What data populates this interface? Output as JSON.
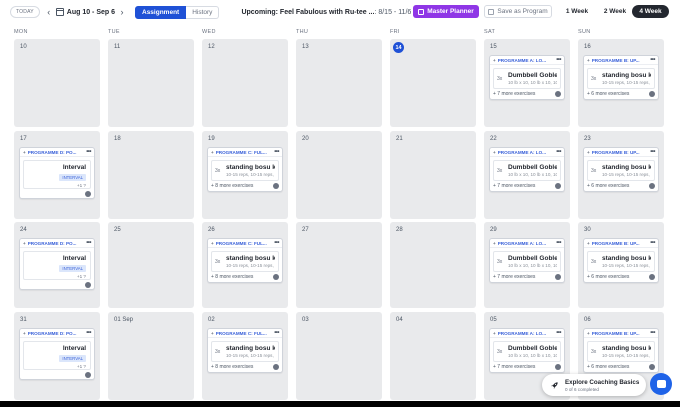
{
  "toolbar": {
    "today": "TODAY",
    "date_range": "Aug 10 - Sep 6",
    "tabs": [
      "Assignment",
      "History"
    ],
    "upcoming_title": "Upcoming: Feel Fabulous with Ru-tee ...",
    "upcoming_range": ": 8/15 - 11/6",
    "more": "•••",
    "master_planner": "Master Planner",
    "save_program": "Save as Program",
    "week_options": [
      "1 Week",
      "2 Week",
      "4 Week"
    ],
    "selected_week": "4 Week",
    "colors": {
      "primary": "#1f51d6",
      "master": "#8f36e6",
      "selected_week_bg": "#23272f"
    }
  },
  "days": [
    "MON",
    "TUE",
    "WED",
    "THU",
    "FRI",
    "SAT",
    "SUN"
  ],
  "today_day": "14",
  "weeks": [
    [
      {
        "day": "10"
      },
      {
        "day": "11"
      },
      {
        "day": "12"
      },
      {
        "day": "13"
      },
      {
        "day": "14",
        "today": true
      },
      {
        "day": "15",
        "card": {
          "type": "exercise",
          "program": "PROGRAMME A: LO...",
          "sets": "3x",
          "name": "Dumbbell Goblet ...",
          "detail": "10 lb x 10, 10 lb x 10, 10 lb...",
          "more": "+ 7 more exercises"
        }
      },
      {
        "day": "16",
        "card": {
          "type": "exercise",
          "program": "PROGRAMME B: UP...",
          "sets": "3x",
          "name": "standing bosu kn...",
          "detail": "10-15 reps, 10-15 reps, 10...",
          "more": "+ 6 more exercises"
        }
      }
    ],
    [
      {
        "day": "17",
        "card": {
          "type": "interval",
          "program": "PROGRAMME D: PO...",
          "name": "Interval",
          "badge": "INTERVAL",
          "more": "+1 ?"
        }
      },
      {
        "day": "18"
      },
      {
        "day": "19",
        "card": {
          "type": "exercise",
          "program": "PROGRAMME C: FUL...",
          "sets": "3x",
          "name": "standing bosu kn...",
          "detail": "10-15 reps, 10-15 reps, 10...",
          "more": "+ 8 more exercises"
        }
      },
      {
        "day": "20"
      },
      {
        "day": "21"
      },
      {
        "day": "22",
        "card": {
          "type": "exercise",
          "program": "PROGRAMME A: LO...",
          "sets": "3x",
          "name": "Dumbbell Goblet ...",
          "detail": "10 lb x 10, 10 lb x 10, 10 lb...",
          "more": "+ 7 more exercises"
        }
      },
      {
        "day": "23",
        "card": {
          "type": "exercise",
          "program": "PROGRAMME B: UP...",
          "sets": "3x",
          "name": "standing bosu kn...",
          "detail": "10-15 reps, 10-15 reps, 10...",
          "more": "+ 6 more exercises"
        }
      }
    ],
    [
      {
        "day": "24",
        "card": {
          "type": "interval",
          "program": "PROGRAMME D: PO...",
          "name": "Interval",
          "badge": "INTERVAL",
          "more": "+1 ?"
        }
      },
      {
        "day": "25"
      },
      {
        "day": "26",
        "card": {
          "type": "exercise",
          "program": "PROGRAMME C: FUL...",
          "sets": "3x",
          "name": "standing bosu kn...",
          "detail": "10-15 reps, 10-15 reps, 10...",
          "more": "+ 8 more exercises"
        }
      },
      {
        "day": "27"
      },
      {
        "day": "28"
      },
      {
        "day": "29",
        "card": {
          "type": "exercise",
          "program": "PROGRAMME A: LO...",
          "sets": "3x",
          "name": "Dumbbell Goblet ...",
          "detail": "10 lb x 10, 10 lb x 10, 10 lb...",
          "more": "+ 7 more exercises"
        }
      },
      {
        "day": "30",
        "card": {
          "type": "exercise",
          "program": "PROGRAMME B: UP...",
          "sets": "3x",
          "name": "standing bosu kn...",
          "detail": "10-15 reps, 10-15 reps, 10...",
          "more": "+ 6 more exercises"
        }
      }
    ],
    [
      {
        "day": "31",
        "card": {
          "type": "interval",
          "program": "PROGRAMME D: PO...",
          "name": "Interval",
          "badge": "INTERVAL",
          "more": "+1 ?"
        }
      },
      {
        "day": "01 Sep"
      },
      {
        "day": "02",
        "card": {
          "type": "exercise",
          "program": "PROGRAMME C: FUL...",
          "sets": "3x",
          "name": "standing bosu kn...",
          "detail": "10-15 reps, 10-15 reps, 10...",
          "more": "+ 8 more exercises"
        }
      },
      {
        "day": "03"
      },
      {
        "day": "04"
      },
      {
        "day": "05",
        "card": {
          "type": "exercise",
          "program": "PROGRAMME A: LO...",
          "sets": "3x",
          "name": "Dumbbell Goblet ...",
          "detail": "10 lb x 10, 10 lb x 10, 10 lb...",
          "more": "+ 7 more exercises"
        }
      },
      {
        "day": "06",
        "card": {
          "type": "exercise",
          "program": "PROGRAMME B: UP...",
          "sets": "3x",
          "name": "standing bosu kn...",
          "detail": "10-15 reps, 10-15 reps, 10...",
          "more": "+ 6 more exercises"
        }
      }
    ]
  ],
  "explore": {
    "title": "Explore Coaching Basics",
    "subtitle": "0 of 6 completed",
    "icon": "rocket-icon"
  },
  "chat": {
    "icon": "chat-icon",
    "color": "#1f63e8"
  }
}
